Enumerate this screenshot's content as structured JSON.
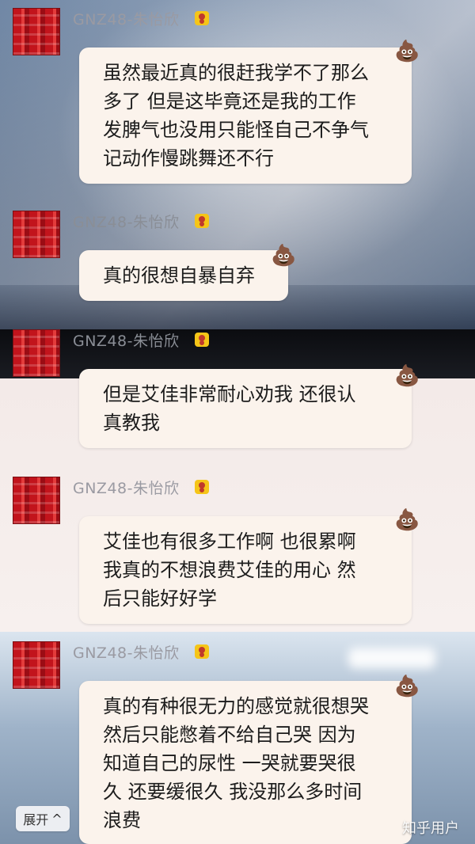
{
  "messages": [
    {
      "sender": "GNZ48-朱怡欣",
      "lines": [
        "虽然最近真的很赶我学不了那么",
        "多了  但是这毕竟还是我的工作",
        "发脾气也没用只能怪自己不争气",
        "记动作慢跳舞还不行"
      ]
    },
    {
      "sender": "GNZ48-朱怡欣",
      "lines": [
        "真的很想自暴自弃"
      ]
    },
    {
      "sender": "GNZ48-朱怡欣",
      "lines": [
        "但是艾佳非常耐心劝我  还很认",
        "真教我"
      ]
    },
    {
      "sender": "GNZ48-朱怡欣",
      "lines": [
        "艾佳也有很多工作啊  也很累啊",
        "我真的不想浪费艾佳的用心  然",
        "后只能好好学"
      ]
    },
    {
      "sender": "GNZ48-朱怡欣",
      "lines": [
        "真的有种很无力的感觉就很想哭",
        "然后只能憋着不给自己哭  因为",
        "知道自己的尿性  一哭就要哭很",
        "久  还要缓很久  我没那么多时间",
        "浪费"
      ]
    }
  ],
  "icons": {
    "emoji": "💩",
    "badge": "crown-badge-icon"
  },
  "expand_button": {
    "label": "展开",
    "chevron": "^"
  },
  "watermark": "知乎用户",
  "colors": {
    "bubble": "#fbf3ec",
    "sender": "#9a9aa2",
    "badge": "#f5c518",
    "avatar": "#c2141c"
  }
}
